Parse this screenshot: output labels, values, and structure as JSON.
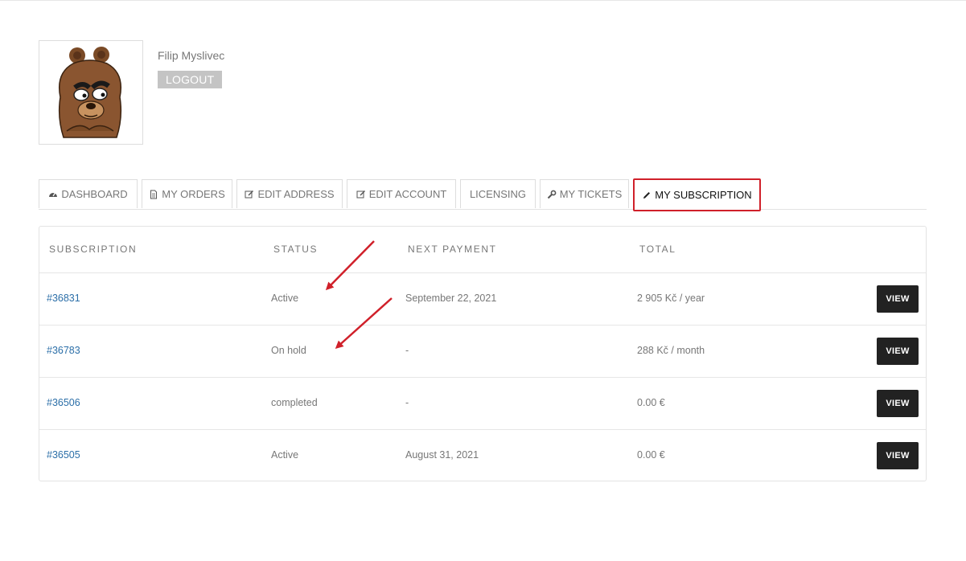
{
  "user": {
    "name": "Filip Myslivec",
    "logout_label": "LOGOUT"
  },
  "tabs": [
    {
      "label": "DASHBOARD",
      "icon": "dashboard-icon"
    },
    {
      "label": "MY ORDERS",
      "icon": "file-icon"
    },
    {
      "label": "EDIT ADDRESS",
      "icon": "edit-icon"
    },
    {
      "label": "EDIT ACCOUNT",
      "icon": "edit-icon"
    },
    {
      "label": "LICENSING",
      "icon": ""
    },
    {
      "label": "MY TICKETS",
      "icon": "wrench-icon"
    },
    {
      "label": "MY SUBSCRIPTION",
      "icon": "pencil-icon",
      "active": true
    }
  ],
  "table": {
    "headers": {
      "subscription": "SUBSCRIPTION",
      "status": "STATUS",
      "next_payment": "NEXT PAYMENT",
      "total": "TOTAL"
    },
    "view_label": "VIEW",
    "rows": [
      {
        "id": "#36831",
        "status": "Active",
        "next_payment": "September 22, 2021",
        "total": "2 905 Kč / year"
      },
      {
        "id": "#36783",
        "status": "On hold",
        "next_payment": "-",
        "total": "288 Kč / month"
      },
      {
        "id": "#36506",
        "status": "completed",
        "next_payment": "-",
        "total": "0.00 €"
      },
      {
        "id": "#36505",
        "status": "Active",
        "next_payment": "August 31, 2021",
        "total": "0.00 €"
      }
    ]
  },
  "colors": {
    "highlight": "#d0202a",
    "link": "#2c6fa8",
    "button_dark": "#222222",
    "logout_bg": "#c4c4c4"
  }
}
